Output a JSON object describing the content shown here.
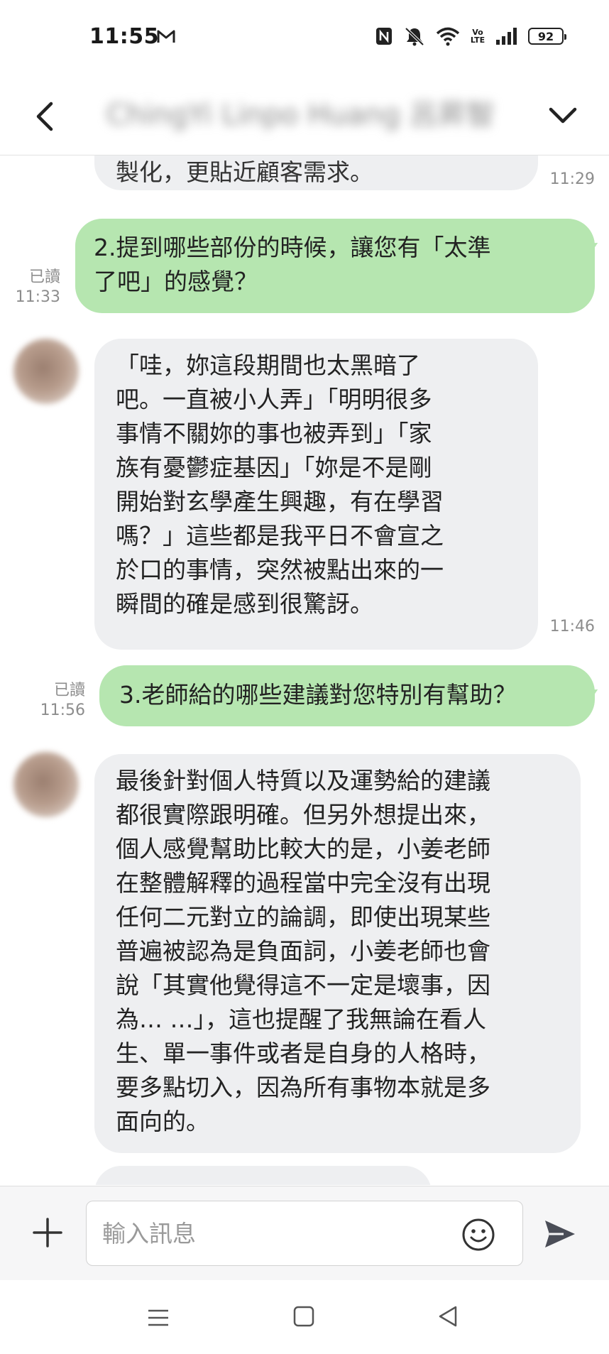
{
  "status_bar": {
    "time": "11:55",
    "mail_icon": "gmail-m-icon",
    "battery": "92",
    "volte_label": "Vo LTE"
  },
  "header": {
    "title": "ChingYi Linpo Huang 呂昇智",
    "back_icon": "chevron-left-icon",
    "expand_icon": "chevron-down-icon"
  },
  "messages": [
    {
      "direction": "in",
      "text": "製化，更貼近顧客需求。",
      "time": "11:29"
    },
    {
      "direction": "out",
      "lines": [
        "2.提到哪些部份的時候，讓您有「太準",
        "了吧」的感覺？"
      ],
      "read_label": "已讀",
      "time": "11:33"
    },
    {
      "direction": "in",
      "lines": [
        "「哇，妳這段期間也太黑暗了",
        "吧。一直被小人弄」「明明很多",
        "事情不關妳的事也被弄到」「家",
        "族有憂鬱症基因」「妳是不是剛",
        "開始對玄學產生興趣，有在學習",
        "嗎？」這些都是我平日不會宣之",
        "於口的事情，突然被點出來的一",
        "瞬間的確是感到很驚訝。"
      ],
      "time": "11:46"
    },
    {
      "direction": "out",
      "lines": [
        "3.老師給的哪些建議對您特別有幫助？"
      ],
      "read_label": "已讀",
      "time": "11:56"
    },
    {
      "direction": "in",
      "lines": [
        "最後針對個人特質以及運勢給的建議",
        "都很實際跟明確。但另外想提出來，",
        "個人感覺幫助比較大的是，小姜老師",
        "在整體解釋的過程當中完全沒有出現",
        "任何二元對立的論調，即使出現某些",
        "普遍被認為是負面詞，小姜老師也會",
        "說「其實他覺得這不一定是壞事，因",
        "為… …」，這也提醒了我無論在看人",
        "生、單一事件或者是自身的人格時，",
        "要多點切入，因為所有事物本就是多",
        "面向的。"
      ]
    }
  ],
  "input": {
    "placeholder": "輸入訊息",
    "plus_icon": "plus-icon",
    "emoji_icon": "smiley-icon",
    "send_icon": "send-icon"
  },
  "nav": {
    "menu_icon": "menu-icon",
    "home_icon": "home-square-icon",
    "back_icon": "back-triangle-icon"
  },
  "colors": {
    "outgoing_bubble": "#b6e6b0",
    "incoming_bubble": "#eeeff1",
    "timestamp": "#8d8d8d"
  }
}
